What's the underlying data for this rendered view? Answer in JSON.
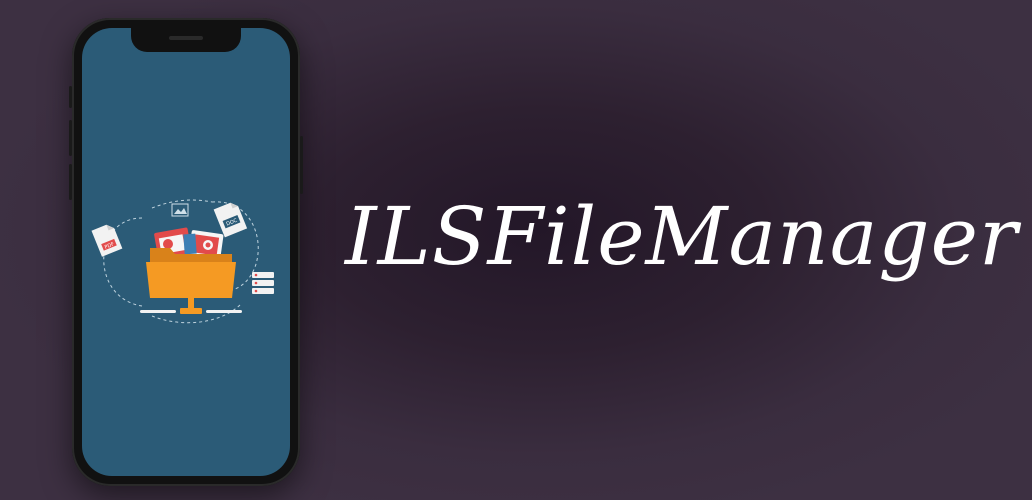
{
  "title": "ILSFileManager",
  "illustration": {
    "file_badges": [
      "PDF",
      "DOC"
    ]
  },
  "colors": {
    "background": "#3d3042",
    "screen": "#2b5b77",
    "folder": "#f59a23",
    "accent_red": "#e24b4b"
  }
}
